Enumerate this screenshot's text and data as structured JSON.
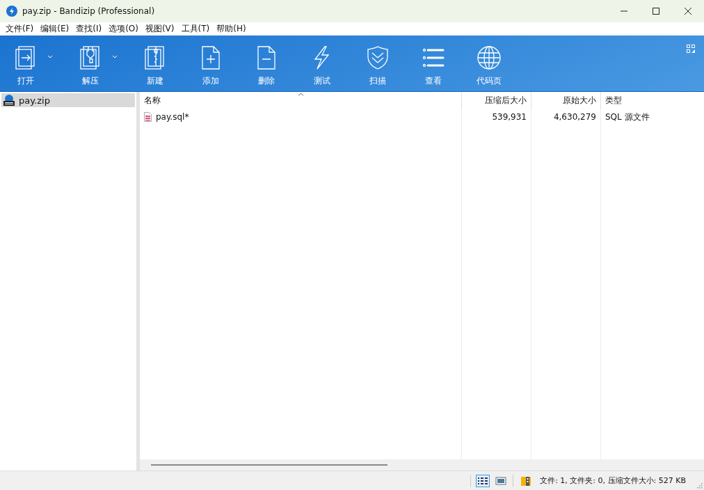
{
  "window": {
    "title": "pay.zip - Bandizip (Professional)"
  },
  "menu": [
    "文件(F)",
    "编辑(E)",
    "查找(I)",
    "选项(O)",
    "视图(V)",
    "工具(T)",
    "帮助(H)"
  ],
  "toolbar": [
    {
      "label": "打开",
      "dropdown": true
    },
    {
      "label": "解压",
      "dropdown": true
    },
    {
      "label": "新建",
      "dropdown": false
    },
    {
      "label": "添加",
      "dropdown": false
    },
    {
      "label": "删除",
      "dropdown": false
    },
    {
      "label": "测试",
      "dropdown": false
    },
    {
      "label": "扫描",
      "dropdown": false
    },
    {
      "label": "查看",
      "dropdown": false
    },
    {
      "label": "代码页",
      "dropdown": false
    }
  ],
  "sidebar": {
    "items": [
      {
        "label": "pay.zip",
        "selected": true
      }
    ]
  },
  "table": {
    "columns": [
      {
        "label": "名称",
        "sorted": true
      },
      {
        "label": "压缩后大小",
        "sorted": false
      },
      {
        "label": "原始大小",
        "sorted": false
      },
      {
        "label": "类型",
        "sorted": false
      }
    ],
    "rows": [
      {
        "cells": [
          "pay.sql*",
          "539,931",
          "4,630,279",
          "SQL 源文件"
        ],
        "selected": false
      }
    ]
  },
  "status_bar": {
    "views": [
      {
        "selected": true
      },
      {
        "selected": false
      }
    ],
    "text": "文件: 1, 文件夹: 0, 压缩文件大小: 527 KB"
  }
}
